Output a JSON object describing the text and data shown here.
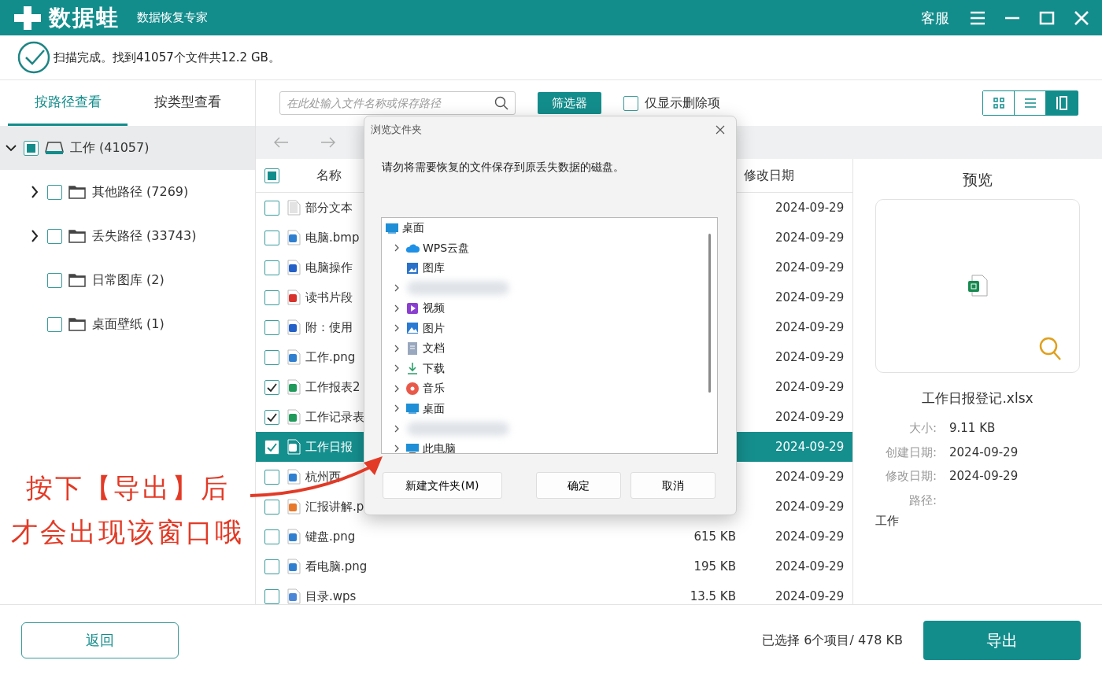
{
  "app": {
    "logo_text": "数据蛙",
    "subtitle": "数据恢复专家",
    "support": "客服"
  },
  "scan_status": "扫描完成。找到41057个文件共12.2 GB。",
  "sidebar": {
    "tabs": [
      {
        "label": "按路径查看",
        "selected": true
      },
      {
        "label": "按类型查看",
        "selected": false
      }
    ],
    "tree": [
      {
        "label": "工作 (41057)",
        "kind": "drive",
        "expanded": true,
        "checked": false,
        "partial": true,
        "selected": true,
        "children": [
          {
            "label": "其他路径 (7269)",
            "kind": "folder",
            "expanded": false,
            "checked": false,
            "partial": false,
            "selected": false
          },
          {
            "label": "丢失路径 (33743)",
            "kind": "folder",
            "expanded": false,
            "checked": false,
            "partial": false,
            "selected": false
          },
          {
            "label": "日常图库 (2)",
            "kind": "folder",
            "checked": false,
            "partial": false,
            "selected": false
          },
          {
            "label": "桌面壁纸 (1)",
            "kind": "folder",
            "checked": false,
            "partial": false,
            "selected": false
          }
        ]
      }
    ]
  },
  "toolbar": {
    "search_placeholder": "在此处输入文件名称或保存路径",
    "filter_button": "筛选器",
    "deleted_only": {
      "label": "仅显示删除项",
      "checked": false
    },
    "view_buttons": [
      {
        "kind": "grid",
        "selected": false
      },
      {
        "kind": "list",
        "selected": false
      },
      {
        "kind": "columns",
        "selected": true
      }
    ]
  },
  "table": {
    "name_header": "名称",
    "date_header": "修改日期",
    "header_checkbox": {
      "checked": false,
      "partial": true
    },
    "rows": [
      {
        "name": "部分文本",
        "kind": "blank",
        "date": "2024-09-29",
        "checked": false,
        "selected": false
      },
      {
        "name": "电脑.bmp",
        "kind": "image",
        "date": "2024-09-29",
        "checked": false,
        "selected": false
      },
      {
        "name": "电脑操作",
        "kind": "slides",
        "date": "2024-09-29",
        "checked": false,
        "selected": false
      },
      {
        "name": "读书片段",
        "kind": "pdf",
        "date": "2024-09-29",
        "checked": false,
        "selected": false
      },
      {
        "name": "附：使用",
        "kind": "slides",
        "date": "2024-09-29",
        "checked": false,
        "selected": false
      },
      {
        "name": "工作.png",
        "kind": "image",
        "date": "2024-09-29",
        "checked": false,
        "selected": false
      },
      {
        "name": "工作报表2",
        "kind": "sheet",
        "date": "2024-09-29",
        "checked": true,
        "selected": false
      },
      {
        "name": "工作记录表",
        "kind": "sheet",
        "date": "2024-09-29",
        "checked": true,
        "selected": false
      },
      {
        "name": "工作日报",
        "kind": "sheet",
        "date": "2024-09-29",
        "checked": true,
        "selected": true
      },
      {
        "name": "杭州西",
        "kind": "image",
        "date": "2024-09-29",
        "checked": false,
        "selected": false
      },
      {
        "name": "汇报讲解.p",
        "kind": "ppt",
        "date": "2024-09-29",
        "checked": false,
        "selected": false
      },
      {
        "name": "键盘.png",
        "kind": "image",
        "size": "615 KB",
        "date": "2024-09-29",
        "checked": false,
        "selected": false
      },
      {
        "name": "看电脑.png",
        "kind": "image",
        "size": "195 KB",
        "date": "2024-09-29",
        "checked": false,
        "selected": false
      },
      {
        "name": "目录.wps",
        "kind": "wps",
        "size": "13.5 KB",
        "date": "2024-09-29",
        "checked": false,
        "selected": false
      }
    ]
  },
  "preview": {
    "title": "预览",
    "file_name": "工作日报登记.xlsx",
    "details": [
      {
        "label": "大小:",
        "value": "9.11 KB"
      },
      {
        "label": "创建日期:",
        "value": "2024-09-29"
      },
      {
        "label": "修改日期:",
        "value": "2024-09-29"
      }
    ],
    "path_label": "路径:",
    "path_value": "工作"
  },
  "dialog": {
    "title": "浏览文件夹",
    "message": "请勿将需要恢复的文件保存到原丢失数据的磁盘。",
    "tree": [
      {
        "label": "桌面",
        "kind": "desktop",
        "expandable": false,
        "children": [
          {
            "label": "WPS云盘",
            "kind": "cloud",
            "expandable": true
          },
          {
            "label": "图库",
            "kind": "gallery",
            "expandable": false
          },
          {
            "kind": "blurred",
            "expandable": true
          },
          {
            "label": "视频",
            "kind": "video",
            "expandable": true
          },
          {
            "label": "图片",
            "kind": "picture",
            "expandable": true
          },
          {
            "label": "文档",
            "kind": "docs",
            "expandable": true
          },
          {
            "label": "下载",
            "kind": "download",
            "expandable": true
          },
          {
            "label": "音乐",
            "kind": "music",
            "expandable": true
          },
          {
            "label": "桌面",
            "kind": "desktop",
            "expandable": true
          },
          {
            "kind": "blurred",
            "expandable": true
          },
          {
            "label": "此电脑",
            "kind": "pc",
            "expandable": true
          }
        ]
      }
    ],
    "buttons": [
      {
        "label": "新建文件夹(M)"
      },
      {
        "label": "确定"
      },
      {
        "label": "取消"
      }
    ]
  },
  "annotation_lines": [
    "按下【导出】后",
    "才会出现该窗口哦"
  ],
  "footer": {
    "back_button": "返回",
    "selection_summary": "已选择 6个项目/ 478 KB",
    "export_button": "导出"
  }
}
